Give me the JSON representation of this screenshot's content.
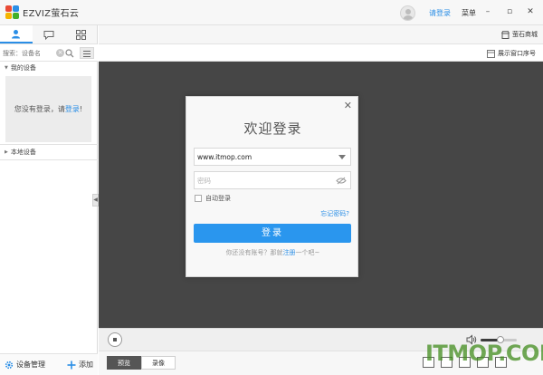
{
  "app": {
    "logo_text": "EZVIZ萤石云"
  },
  "titlebar": {
    "login_label": "请登录",
    "menu_label": "菜单",
    "min_icon": "–",
    "max_icon": "▫",
    "close_icon": "✕"
  },
  "sidebar": {
    "search_placeholder": "搜索：设备名",
    "my_devices_label": "我的设备",
    "empty_text": "您没有登录，请",
    "empty_link": "登录",
    "empty_suffix": "!",
    "local_devices_label": "本地设备",
    "footer_manage_label": "设备管理",
    "footer_add_label": "添加"
  },
  "toolbar": {
    "shop_label": "萤石商城",
    "window_number_label": "展示窗口序号"
  },
  "login_dialog": {
    "title": "欢迎登录",
    "username_value": "www.itmop.com",
    "password_placeholder": "密码",
    "auto_login_label": "自动登录",
    "auto_login_checked": false,
    "forgot_label": "忘记密码?",
    "submit_label": "登录",
    "register_prefix": "你还没有账号？那就",
    "register_link": "注册",
    "register_suffix": "一个吧~"
  },
  "playback": {
    "volume_level": 0.55
  },
  "mode_tabs": [
    {
      "label": "预览",
      "active": true
    },
    {
      "label": "录像",
      "active": false
    }
  ],
  "watermark": "ITMOP.COM",
  "colors": {
    "accent": "#2a8ee6",
    "video_bg": "#464646",
    "dialog_bg": "#f8f8f8"
  }
}
